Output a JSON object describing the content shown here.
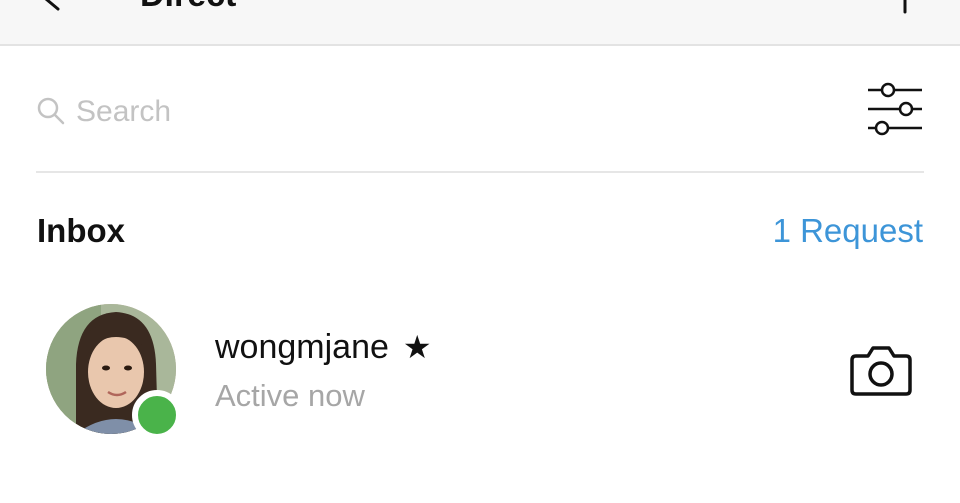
{
  "header": {
    "title": "Direct",
    "back_icon": "back-arrow-icon",
    "new_icon": "plus-icon"
  },
  "search": {
    "placeholder": "Search",
    "icon": "search-icon",
    "filter_icon": "filter-sliders-icon"
  },
  "inbox": {
    "label": "Inbox",
    "request_link": "1 Request",
    "request_color": "#3d95d8"
  },
  "conversations": [
    {
      "username": "wongmjane",
      "star": "★",
      "status": "Active now",
      "status_color": "#4ab34a",
      "action_icon": "camera-icon"
    }
  ]
}
